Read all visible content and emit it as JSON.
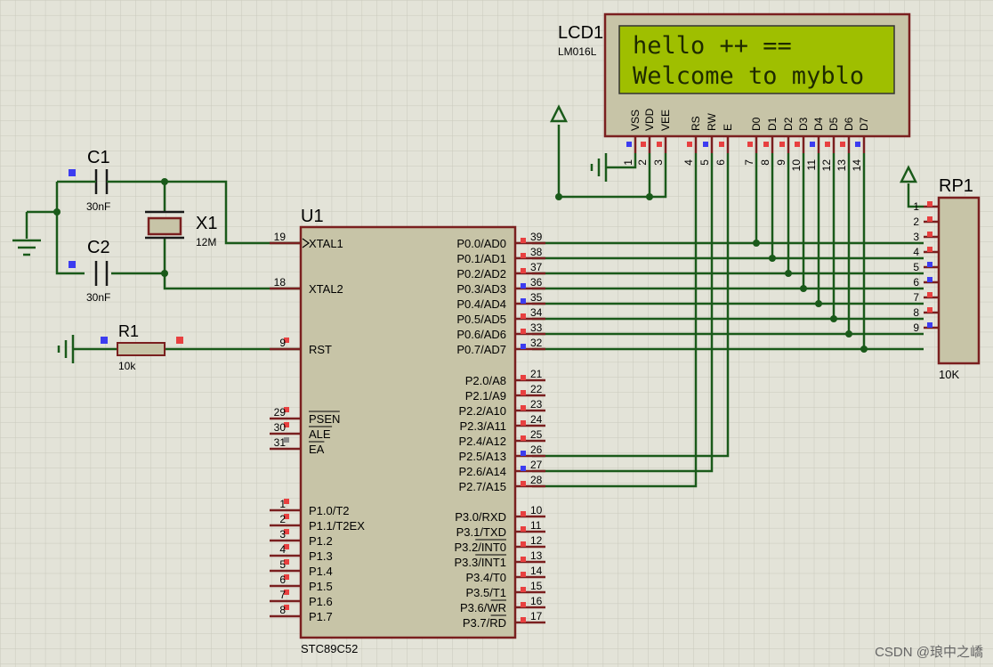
{
  "colors": {
    "background": "#e3e3d8",
    "grid": "#c9c9bc",
    "body": "#c7c4a7",
    "outline": "#7a1f1f",
    "wire": "#1a5a1a",
    "pin_red": "#e84040",
    "pin_blue": "#3c3cf0",
    "pin_gray": "#8a8a8a",
    "lcd_screen": "#9fbf00",
    "text": "#000000"
  },
  "lcd": {
    "ref": "LCD1",
    "model": "LM016L",
    "line1": "hello ++ ==",
    "line2": "Welcome to myblo",
    "pins": [
      {
        "name": "VSS",
        "num": "1",
        "state": "blue"
      },
      {
        "name": "VDD",
        "num": "2",
        "state": "red"
      },
      {
        "name": "VEE",
        "num": "3",
        "state": "red"
      },
      {
        "name": "RS",
        "num": "4",
        "state": "red"
      },
      {
        "name": "RW",
        "num": "5",
        "state": "blue"
      },
      {
        "name": "E",
        "num": "6",
        "state": "red"
      },
      {
        "name": "D0",
        "num": "7",
        "state": "red"
      },
      {
        "name": "D1",
        "num": "8",
        "state": "red"
      },
      {
        "name": "D2",
        "num": "9",
        "state": "red"
      },
      {
        "name": "D3",
        "num": "10",
        "state": "red"
      },
      {
        "name": "D4",
        "num": "11",
        "state": "blue"
      },
      {
        "name": "D5",
        "num": "12",
        "state": "red"
      },
      {
        "name": "D6",
        "num": "13",
        "state": "red"
      },
      {
        "name": "D7",
        "num": "14",
        "state": "blue"
      }
    ]
  },
  "mcu": {
    "ref": "U1",
    "model": "STC89C52",
    "left_pins": [
      {
        "name": "XTAL1",
        "num": "19",
        "state": "none"
      },
      {
        "name": "XTAL2",
        "num": "18",
        "state": "none"
      },
      {
        "name": "RST",
        "num": "9",
        "state": "red"
      },
      {
        "name": "PSEN",
        "num": "29",
        "state": "red"
      },
      {
        "name": "ALE",
        "num": "30",
        "state": "red"
      },
      {
        "name": "EA",
        "num": "31",
        "state": "gray"
      },
      {
        "name": "P1.0/T2",
        "num": "1",
        "state": "red"
      },
      {
        "name": "P1.1/T2EX",
        "num": "2",
        "state": "red"
      },
      {
        "name": "P1.2",
        "num": "3",
        "state": "red"
      },
      {
        "name": "P1.3",
        "num": "4",
        "state": "red"
      },
      {
        "name": "P1.4",
        "num": "5",
        "state": "red"
      },
      {
        "name": "P1.5",
        "num": "6",
        "state": "red"
      },
      {
        "name": "P1.6",
        "num": "7",
        "state": "red"
      },
      {
        "name": "P1.7",
        "num": "8",
        "state": "red"
      }
    ],
    "port0_pins": [
      {
        "name": "P0.0/AD0",
        "num": "39",
        "state": "red"
      },
      {
        "name": "P0.1/AD1",
        "num": "38",
        "state": "red"
      },
      {
        "name": "P0.2/AD2",
        "num": "37",
        "state": "red"
      },
      {
        "name": "P0.3/AD3",
        "num": "36",
        "state": "blue"
      },
      {
        "name": "P0.4/AD4",
        "num": "35",
        "state": "blue"
      },
      {
        "name": "P0.5/AD5",
        "num": "34",
        "state": "red"
      },
      {
        "name": "P0.6/AD6",
        "num": "33",
        "state": "red"
      },
      {
        "name": "P0.7/AD7",
        "num": "32",
        "state": "blue"
      }
    ],
    "port2_pins": [
      {
        "name": "P2.0/A8",
        "num": "21",
        "state": "red"
      },
      {
        "name": "P2.1/A9",
        "num": "22",
        "state": "red"
      },
      {
        "name": "P2.2/A10",
        "num": "23",
        "state": "red"
      },
      {
        "name": "P2.3/A11",
        "num": "24",
        "state": "red"
      },
      {
        "name": "P2.4/A12",
        "num": "25",
        "state": "red"
      },
      {
        "name": "P2.5/A13",
        "num": "26",
        "state": "blue"
      },
      {
        "name": "P2.6/A14",
        "num": "27",
        "state": "blue"
      },
      {
        "name": "P2.7/A15",
        "num": "28",
        "state": "red"
      }
    ],
    "port3_pins": [
      {
        "name": "P3.0/RXD",
        "num": "10",
        "state": "red"
      },
      {
        "name": "P3.1/TXD",
        "num": "11",
        "state": "red"
      },
      {
        "name": "P3.2/INT0",
        "num": "12",
        "state": "red"
      },
      {
        "name": "P3.3/INT1",
        "num": "13",
        "state": "red"
      },
      {
        "name": "P3.4/T0",
        "num": "14",
        "state": "red"
      },
      {
        "name": "P3.5/T1",
        "num": "15",
        "state": "red"
      },
      {
        "name": "P3.6/WR",
        "num": "16",
        "state": "red"
      },
      {
        "name": "P3.7/RD",
        "num": "17",
        "state": "red"
      }
    ]
  },
  "rp1": {
    "ref": "RP1",
    "value": "10K",
    "pins": [
      {
        "num": "1",
        "state": "red"
      },
      {
        "num": "2",
        "state": "red"
      },
      {
        "num": "3",
        "state": "red"
      },
      {
        "num": "4",
        "state": "red"
      },
      {
        "num": "5",
        "state": "blue"
      },
      {
        "num": "6",
        "state": "blue"
      },
      {
        "num": "7",
        "state": "red"
      },
      {
        "num": "8",
        "state": "red"
      },
      {
        "num": "9",
        "state": "blue"
      }
    ]
  },
  "c1": {
    "ref": "C1",
    "value": "30nF"
  },
  "c2": {
    "ref": "C2",
    "value": "30nF"
  },
  "x1": {
    "ref": "X1",
    "value": "12M"
  },
  "r1": {
    "ref": "R1",
    "value": "10k"
  },
  "watermark": "CSDN @琅中之嶠"
}
